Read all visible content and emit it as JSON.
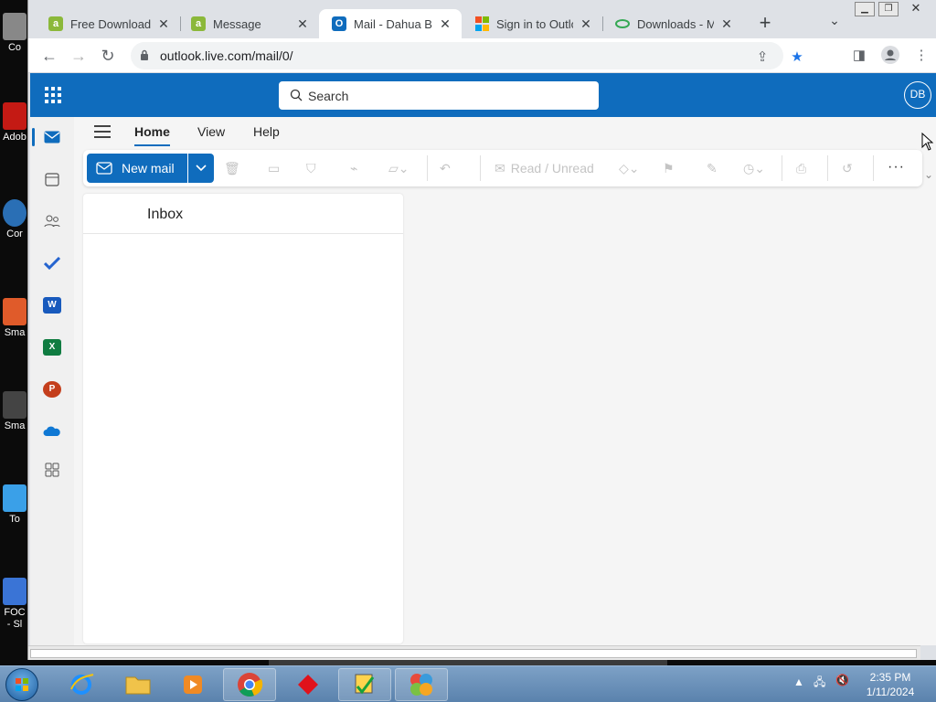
{
  "desktop": {
    "icons": [
      {
        "label": "Co",
        "color": "#888888"
      },
      {
        "label": "Adob",
        "color": "#c41a14"
      },
      {
        "label": "Cor",
        "color": "#2a6fb5"
      },
      {
        "label": "Sma",
        "color": "#e05b2a"
      },
      {
        "label": "Sma",
        "color": "#444444"
      },
      {
        "label": "To",
        "color": "#3aa0e8"
      },
      {
        "label": "FOC - Sl",
        "color": "#3a74d6"
      }
    ]
  },
  "browser": {
    "tabs": [
      {
        "title": "Free Download A",
        "favicon": "a",
        "favicon_color": "#8bb83a",
        "active": false
      },
      {
        "title": "Message",
        "favicon": "a",
        "favicon_color": "#8bb83a",
        "active": false
      },
      {
        "title": "Mail - Dahua Be",
        "favicon": "O",
        "favicon_color": "#0f6cbd",
        "active": true
      },
      {
        "title": "Sign in to Outloo",
        "favicon": "ms",
        "favicon_color": "#f25022",
        "active": false
      },
      {
        "title": "Downloads - Mo",
        "favicon": "dl",
        "favicon_color": "#34a853",
        "active": false
      }
    ],
    "new_tab": "+",
    "url": "outlook.live.com/mail/0/"
  },
  "outlook": {
    "search_placeholder": "Search",
    "avatar_initials": "DB",
    "ribbon_tabs": [
      "Home",
      "View",
      "Help"
    ],
    "new_mail_label": "New mail",
    "read_unread_label": "Read / Unread",
    "folder_title": "Inbox",
    "brand_color": "#0f6cbd"
  },
  "taskbar": {
    "time": "2:35 PM",
    "date": "1/11/2024"
  }
}
